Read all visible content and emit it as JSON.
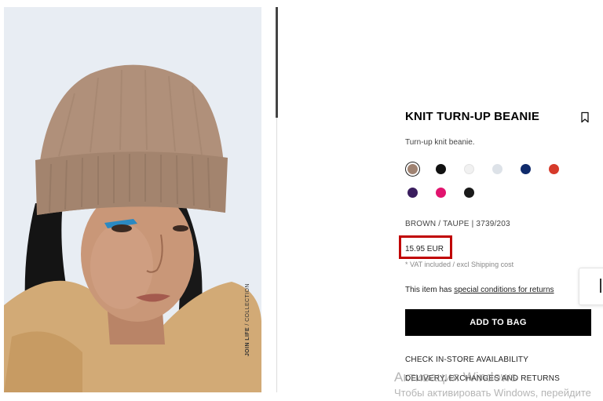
{
  "product": {
    "title": "KNIT TURN-UP BEANIE",
    "description": "Turn-up knit beanie.",
    "variant": "BROWN / TAUPE | 3739/203",
    "price": "15.95 EUR",
    "vat_note": "* VAT included / excl Shipping cost",
    "conditions_prefix": "This item has ",
    "conditions_link": "special conditions for returns",
    "add_to_bag": "ADD TO BAG",
    "links": [
      "CHECK IN-STORE AVAILABILITY",
      "DELIVERY, EXCHANGES AND RETURNS"
    ]
  },
  "photo_caption": {
    "bold": "JOIN LIFE",
    "rest": " / COLLECTION"
  },
  "colors": [
    {
      "name": "brown-taupe",
      "hex": "#a08372",
      "selected": true
    },
    {
      "name": "black",
      "hex": "#111111",
      "selected": false
    },
    {
      "name": "white",
      "hex": "#f1f1f1",
      "selected": false
    },
    {
      "name": "light-grey",
      "hex": "#dde2e8",
      "selected": false
    },
    {
      "name": "navy",
      "hex": "#0f2a6b",
      "selected": false
    },
    {
      "name": "red",
      "hex": "#d63a2a",
      "selected": false
    },
    {
      "name": "purple",
      "hex": "#3a1d5e",
      "selected": false
    },
    {
      "name": "pink",
      "hex": "#e1146e",
      "selected": false
    },
    {
      "name": "black-2",
      "hex": "#1a1a1a",
      "selected": false
    }
  ],
  "accent": {
    "price_highlight": "#c00000",
    "button": "#000000"
  },
  "icons": {
    "bookmark": "bookmark-icon"
  },
  "watermark": {
    "line1": "Активация Windows",
    "line2": "Чтобы активировать Windows, перейдите"
  }
}
